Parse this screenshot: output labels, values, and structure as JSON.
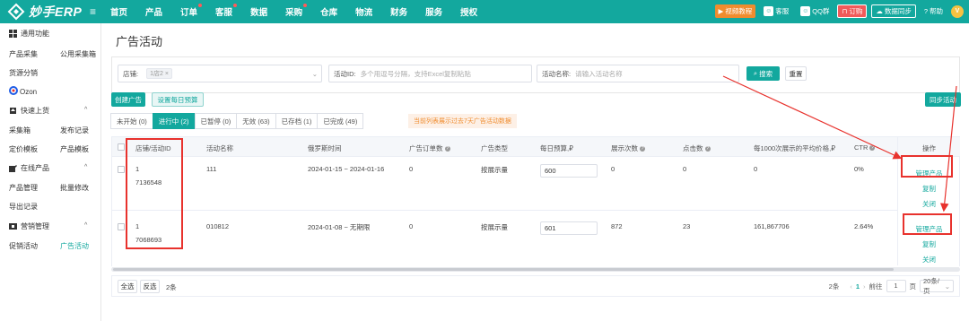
{
  "app": {
    "logo_text": "妙手ERP",
    "nav": [
      "首页",
      "产品",
      "订单",
      "客服",
      "数据",
      "采购",
      "仓库",
      "物流",
      "财务",
      "服务",
      "授权"
    ],
    "nav_dots": [
      false,
      false,
      true,
      true,
      false,
      true,
      false,
      false,
      false,
      false,
      false
    ],
    "top_right": {
      "video": "视频教程",
      "service": "客服",
      "qq": "QQ群",
      "order": "订购",
      "sync": "数据同步",
      "help": "帮助"
    }
  },
  "sidebar": {
    "sections": [
      {
        "title": "通用功能",
        "icon": "grid-icon"
      },
      {
        "title": "快速上货",
        "icon": "upload-icon"
      },
      {
        "title": "在线产品",
        "icon": "edit-icon"
      },
      {
        "title": "营销管理",
        "icon": "marketing-icon"
      }
    ],
    "items": {
      "collect": "产品采集",
      "public_collect": "公用采集箱",
      "distribute": "货源分销",
      "ozon": "Ozon",
      "collect_box": "采集箱",
      "publish_log": "发布记录",
      "pricing_tpl": "定价模板",
      "product_tpl": "产品模板",
      "product_manage": "产品管理",
      "batch_edit": "批量修改",
      "export_log": "导出记录",
      "promo": "促销活动",
      "ads": "广告活动"
    }
  },
  "page": {
    "title": "广告活动",
    "filters": {
      "store_label": "店铺:",
      "store_tag": "1店2",
      "activity_id_label": "活动ID:",
      "activity_id_placeholder": "多个用逗号分隔，支持Excel复制粘贴",
      "activity_name_label": "活动名称:",
      "activity_name_placeholder": "请输入活动名称",
      "search": "搜索",
      "reset": "重置"
    },
    "buttons": {
      "create": "创建广告",
      "daily_budget": "设置每日预算",
      "sync": "同步活动"
    },
    "tabs": [
      {
        "label": "未开始 (0)",
        "active": false
      },
      {
        "label": "进行中 (2)",
        "active": true
      },
      {
        "label": "已暂停 (0)",
        "active": false
      },
      {
        "label": "无效 (63)",
        "active": false
      },
      {
        "label": "已存档 (1)",
        "active": false
      },
      {
        "label": "已完成 (49)",
        "active": false
      }
    ],
    "notice": "当前列表展示过去7天广告活动数据"
  },
  "table": {
    "headers": {
      "store_id": "店铺/活动ID",
      "name": "活动名称",
      "time": "俄罗斯时间",
      "orders": "广告订单数",
      "type": "广告类型",
      "budget": "每日预算,₽",
      "impressions": "展示次数",
      "clicks": "点击数",
      "cpm": "每1000次展示的平均价格,₽",
      "ctr": "CTR",
      "ops": "操作"
    },
    "rows": [
      {
        "store": "1",
        "id": "7136548",
        "name": "111",
        "time": "2024-01-15 ~ 2024-01-16",
        "orders": "0",
        "type": "按展示量",
        "budget": "600",
        "impressions": "0",
        "clicks": "0",
        "cpm": "0",
        "ctr": "0%"
      },
      {
        "store": "1",
        "id": "7068693",
        "name": "010812",
        "time": "2024-01-08 ~ 无期限",
        "orders": "0",
        "type": "按展示量",
        "budget": "601",
        "impressions": "872",
        "clicks": "23",
        "cpm": "161,867706",
        "ctr": "2.64%"
      }
    ],
    "ops": {
      "manage": "管理产品",
      "copy": "复制",
      "close": "关闭"
    }
  },
  "footer": {
    "select_all": "全选",
    "invert": "反选",
    "count_left": "2条",
    "total": "2条",
    "current_page": "1",
    "goto_label": "前往",
    "page_input": "1",
    "page_unit": "页",
    "page_size": "20条/页"
  },
  "colors": {
    "brand": "#13a89e",
    "highlight": "#e8322d",
    "orange": "#f08c2e"
  }
}
